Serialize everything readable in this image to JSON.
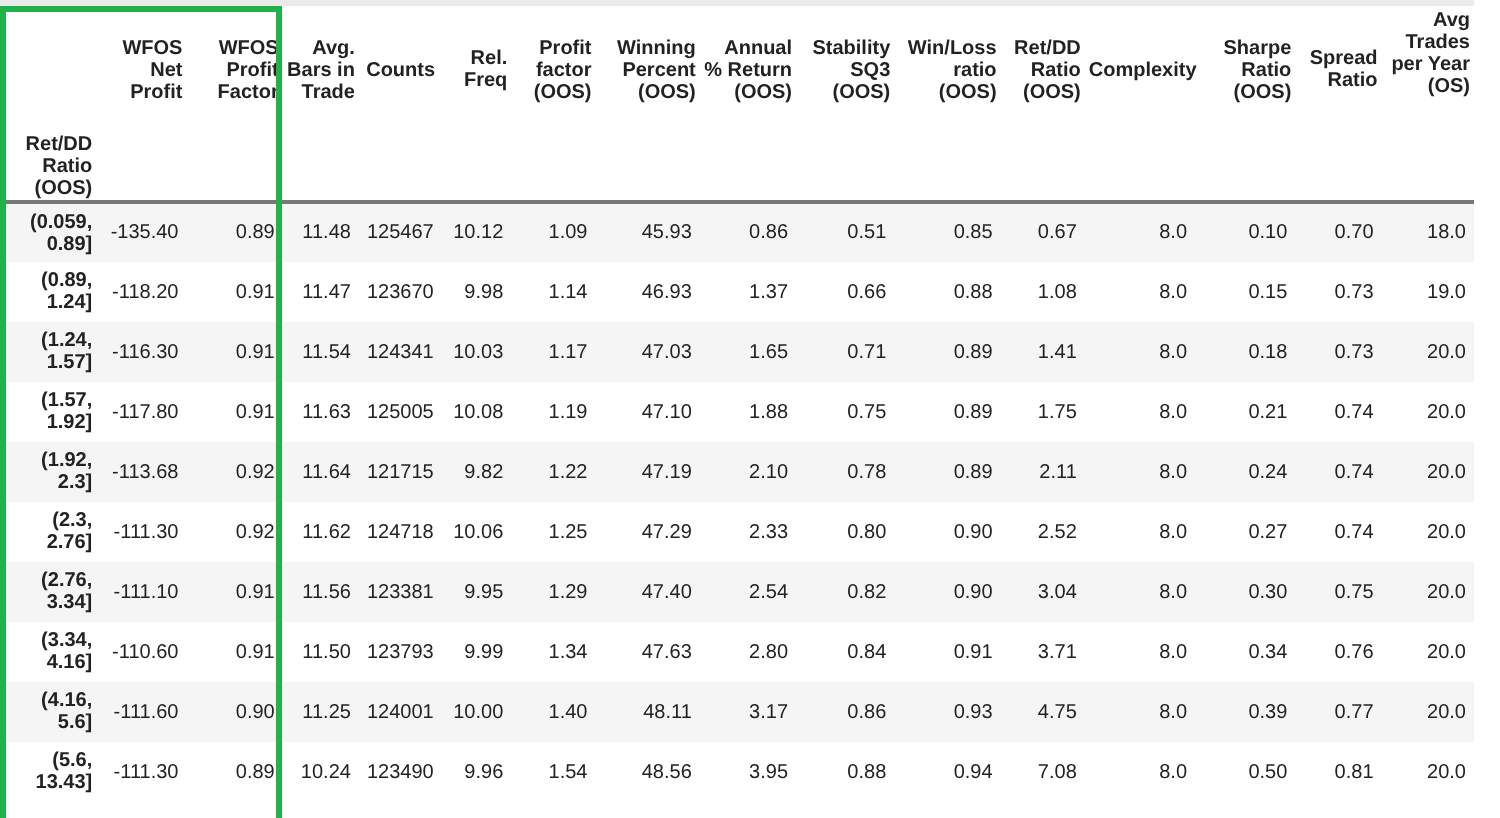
{
  "table": {
    "index_name": "Ret/DD Ratio (OOS)",
    "index_highlighted": true,
    "columns": [
      {
        "label": "WFOS Net Profit",
        "highlighted": true
      },
      {
        "label": "WFOS Profit Factor",
        "highlighted": true
      },
      {
        "label": "Avg. Bars in Trade",
        "highlighted": false
      },
      {
        "label": "Counts",
        "highlighted": false
      },
      {
        "label": "Rel. Freq",
        "highlighted": false
      },
      {
        "label": "Profit factor (OOS)",
        "highlighted": false
      },
      {
        "label": "Winning Percent (OOS)",
        "highlighted": false
      },
      {
        "label": "Annual % Return (OOS)",
        "highlighted": false
      },
      {
        "label": "Stability SQ3 (OOS)",
        "highlighted": false
      },
      {
        "label": "Win/Loss ratio (OOS)",
        "highlighted": false
      },
      {
        "label": "Ret/DD Ratio (OOS)",
        "highlighted": false
      },
      {
        "label": "Complexity",
        "highlighted": false
      },
      {
        "label": "Sharpe Ratio (OOS)",
        "highlighted": false
      },
      {
        "label": "Spread Ratio",
        "highlighted": false
      },
      {
        "label": "Avg Trades per Year (OS)",
        "highlighted": false
      }
    ],
    "rows": [
      {
        "index": "(0.059, 0.89]",
        "cells": [
          "-135.40",
          "0.89",
          "11.48",
          "125467",
          "10.12",
          "1.09",
          "45.93",
          "0.86",
          "0.51",
          "0.85",
          "0.67",
          "8.0",
          "0.10",
          "0.70",
          "18.0"
        ]
      },
      {
        "index": "(0.89, 1.24]",
        "cells": [
          "-118.20",
          "0.91",
          "11.47",
          "123670",
          "9.98",
          "1.14",
          "46.93",
          "1.37",
          "0.66",
          "0.88",
          "1.08",
          "8.0",
          "0.15",
          "0.73",
          "19.0"
        ]
      },
      {
        "index": "(1.24, 1.57]",
        "cells": [
          "-116.30",
          "0.91",
          "11.54",
          "124341",
          "10.03",
          "1.17",
          "47.03",
          "1.65",
          "0.71",
          "0.89",
          "1.41",
          "8.0",
          "0.18",
          "0.73",
          "20.0"
        ]
      },
      {
        "index": "(1.57, 1.92]",
        "cells": [
          "-117.80",
          "0.91",
          "11.63",
          "125005",
          "10.08",
          "1.19",
          "47.10",
          "1.88",
          "0.75",
          "0.89",
          "1.75",
          "8.0",
          "0.21",
          "0.74",
          "20.0"
        ]
      },
      {
        "index": "(1.92, 2.3]",
        "cells": [
          "-113.68",
          "0.92",
          "11.64",
          "121715",
          "9.82",
          "1.22",
          "47.19",
          "2.10",
          "0.78",
          "0.89",
          "2.11",
          "8.0",
          "0.24",
          "0.74",
          "20.0"
        ]
      },
      {
        "index": "(2.3, 2.76]",
        "cells": [
          "-111.30",
          "0.92",
          "11.62",
          "124718",
          "10.06",
          "1.25",
          "47.29",
          "2.33",
          "0.80",
          "0.90",
          "2.52",
          "8.0",
          "0.27",
          "0.74",
          "20.0"
        ]
      },
      {
        "index": "(2.76, 3.34]",
        "cells": [
          "-111.10",
          "0.91",
          "11.56",
          "123381",
          "9.95",
          "1.29",
          "47.40",
          "2.54",
          "0.82",
          "0.90",
          "3.04",
          "8.0",
          "0.30",
          "0.75",
          "20.0"
        ]
      },
      {
        "index": "(3.34, 4.16]",
        "cells": [
          "-110.60",
          "0.91",
          "11.50",
          "123793",
          "9.99",
          "1.34",
          "47.63",
          "2.80",
          "0.84",
          "0.91",
          "3.71",
          "8.0",
          "0.34",
          "0.76",
          "20.0"
        ]
      },
      {
        "index": "(4.16, 5.6]",
        "cells": [
          "-111.60",
          "0.90",
          "11.25",
          "124001",
          "10.00",
          "1.40",
          "48.11",
          "3.17",
          "0.86",
          "0.93",
          "4.75",
          "8.0",
          "0.39",
          "0.77",
          "20.0"
        ]
      },
      {
        "index": "(5.6, 13.43]",
        "cells": [
          "-111.30",
          "0.89",
          "10.24",
          "123490",
          "9.96",
          "1.54",
          "48.56",
          "3.95",
          "0.88",
          "0.94",
          "7.08",
          "8.0",
          "0.50",
          "0.81",
          "20.0"
        ]
      }
    ]
  }
}
